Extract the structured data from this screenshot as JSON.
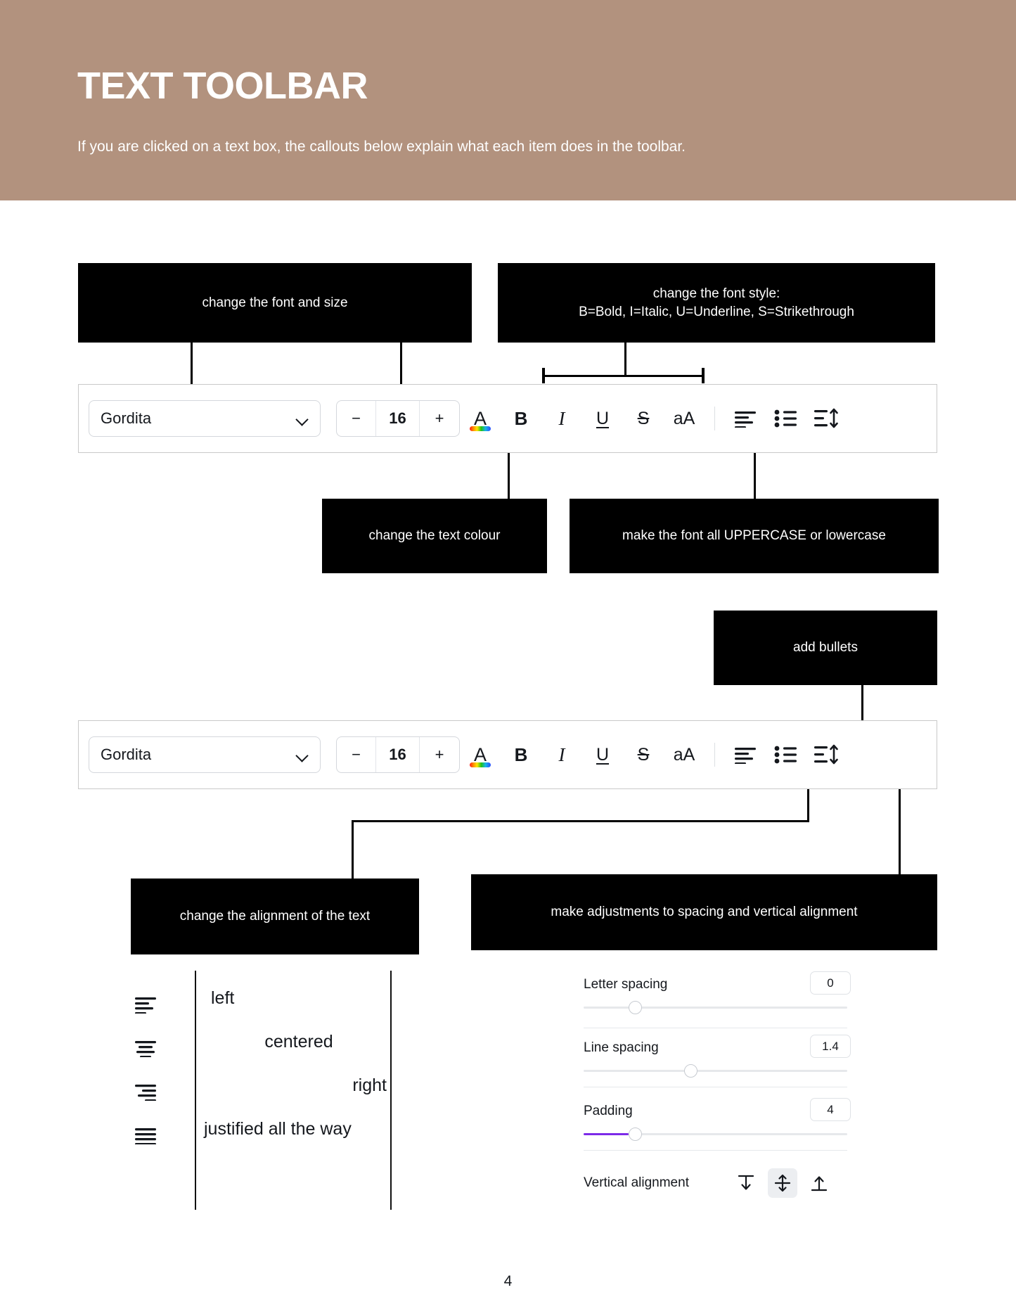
{
  "header": {
    "title": "TEXT TOOLBAR",
    "subtitle": "If you are clicked on a text box, the callouts below explain what each item does in the toolbar.",
    "bg_color": "#b2927e",
    "text_color": "#ffffff"
  },
  "callouts": {
    "font_and_size": "change the font and size",
    "font_style": "change the font style:\nB=Bold, I=Italic, U=Underline, S=Strikethrough",
    "font_style_line1": "change the font style:",
    "font_style_line2": "B=Bold, I=Italic, U=Underline, S=Strikethrough",
    "text_colour": "change the text colour",
    "uppercase": "make the font all UPPERCASE or lowercase",
    "bullets": "add bullets",
    "alignment": "change the alignment of the text",
    "spacing": "make adjustments to spacing and vertical alignment"
  },
  "toolbar": {
    "font_name": "Gordita",
    "size_decrease": "−",
    "size_value": "16",
    "size_increase": "+",
    "buttons": [
      {
        "name": "text-colour",
        "label": "A"
      },
      {
        "name": "bold",
        "label": "B"
      },
      {
        "name": "italic",
        "label": "I"
      },
      {
        "name": "underline",
        "label": "U"
      },
      {
        "name": "strikethrough",
        "label": "S"
      },
      {
        "name": "letter-case",
        "label": "aA"
      }
    ],
    "align_icon": "align-left-icon",
    "bullets_icon": "bulleted-list-icon",
    "spacing_icon": "line-spacing-icon",
    "colors": {
      "rainbow_underline": "rainbow-gradient",
      "border": "#c9c9c9"
    }
  },
  "alignment_demo": [
    {
      "icon": "align-left-icon",
      "text": "left",
      "align": "left"
    },
    {
      "icon": "align-center-icon",
      "text": "centered",
      "align": "center"
    },
    {
      "icon": "align-right-icon",
      "text": "right",
      "align": "right"
    },
    {
      "icon": "align-justify-icon",
      "text": "justified all the way",
      "align": "justify"
    }
  ],
  "spacing_panel": {
    "rows": [
      {
        "label": "Letter spacing",
        "value": "0",
        "knob_pct": 17,
        "filled": false
      },
      {
        "label": "Line spacing",
        "value": "1.4",
        "knob_pct": 38,
        "filled": false
      },
      {
        "label": "Padding",
        "value": "4",
        "knob_pct": 17,
        "filled": true
      }
    ],
    "fill_color": "#7c2ae8",
    "vertical_alignment": {
      "label": "Vertical alignment",
      "options": [
        {
          "name": "align-top-icon",
          "active": false
        },
        {
          "name": "align-middle-icon",
          "active": true
        },
        {
          "name": "align-bottom-icon",
          "active": false
        }
      ]
    }
  },
  "footer": {
    "page_number": "4"
  }
}
